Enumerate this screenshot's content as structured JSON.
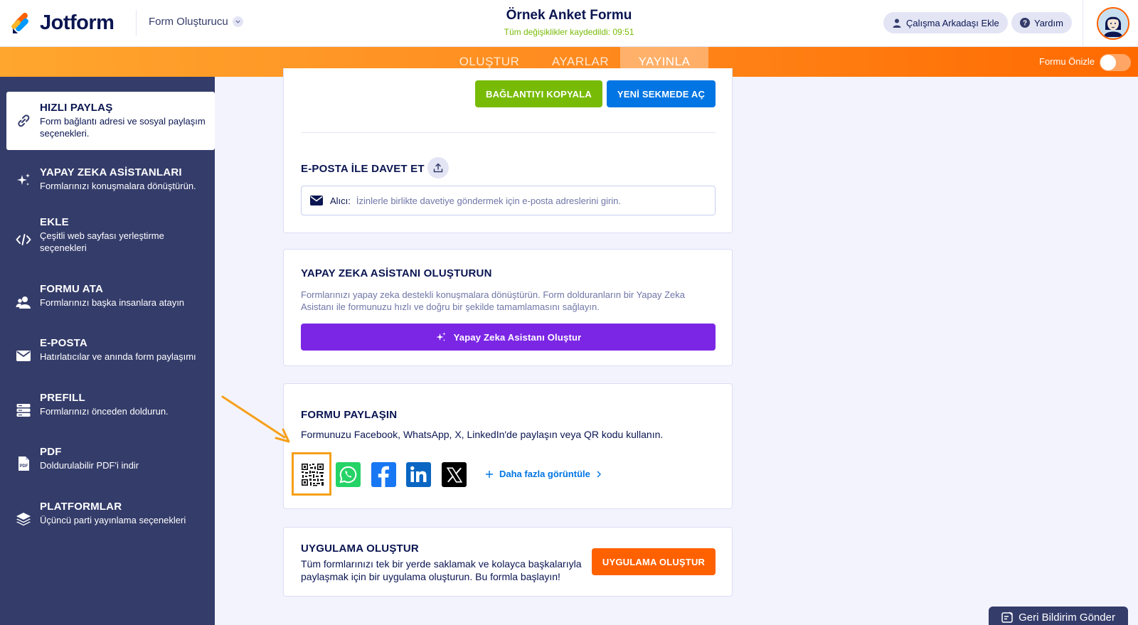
{
  "header": {
    "logo_text": "Jotform",
    "builder_label": "Form Oluşturucu",
    "form_title": "Örnek Anket Formu",
    "saved_status": "Tüm değişiklikler kaydedildi: 09:51",
    "add_collaborator": "Çalışma Arkadaşı Ekle",
    "help": "Yardım"
  },
  "nav": {
    "tabs": [
      "OLUŞTUR",
      "AYARLAR",
      "YAYINLA"
    ],
    "active_tab": "YAYINLA",
    "preview_label": "Formu Önizle",
    "preview_on": false
  },
  "sidebar": {
    "items": [
      {
        "title": "HIZLI PAYLAŞ",
        "desc": "Form bağlantı adresi ve sosyal paylaşım seçenekleri.",
        "icon": "link-icon",
        "active": true
      },
      {
        "title": "YAPAY ZEKA ASİSTANLARI",
        "desc": "Formlarınızı konuşmalara dönüştürün.",
        "icon": "sparkle-icon"
      },
      {
        "title": "EKLE",
        "desc": "Çeşitli web sayfası yerleştirme seçenekleri",
        "icon": "code-icon"
      },
      {
        "title": "FORMU ATA",
        "desc": "Formlarınızı başka insanlara atayın",
        "icon": "users-icon"
      },
      {
        "title": "E-POSTA",
        "desc": "Hatırlatıcılar ve anında form paylaşımı",
        "icon": "mail-icon"
      },
      {
        "title": "PREFILL",
        "desc": "Formlarınızı önceden doldurun.",
        "icon": "prefill-icon"
      },
      {
        "title": "PDF",
        "desc": "Doldurulabilir PDF'i indir",
        "icon": "pdf-icon"
      },
      {
        "title": "PLATFORMLAR",
        "desc": "Üçüncü parti yayınlama seçenekleri",
        "icon": "layers-icon"
      }
    ]
  },
  "link_card": {
    "copy_button": "BAĞLANTIYI KOPYALA",
    "open_button": "YENİ SEKMEDE AÇ",
    "invite_title": "E-POSTA İLE DAVET ET",
    "recipient_label": "Alıcı:",
    "recipient_placeholder": "İzinlerle birlikte davetiye göndermek için e-posta adreslerini girin."
  },
  "ai_card": {
    "title": "YAPAY ZEKA ASİSTANI OLUŞTURUN",
    "desc": "Formlarınızı yapay zeka destekli konuşmalara dönüştürün. Form dolduranların bir Yapay Zeka Asistanı ile formunuzu hızlı ve doğru bir şekilde tamamlamasını sağlayın.",
    "button": "Yapay Zeka Asistanı Oluştur"
  },
  "share_card": {
    "title": "FORMU PAYLAŞIN",
    "desc": "Formunuzu Facebook, WhatsApp, X, LinkedIn'de paylaşın veya QR kodu kullanın.",
    "socials": [
      "qr-code-icon",
      "whatsapp-icon",
      "facebook-icon",
      "linkedin-icon",
      "x-icon"
    ],
    "more_link": "Daha fazla görüntüle"
  },
  "app_card": {
    "title": "UYGULAMA OLUŞTUR",
    "desc": "Tüm formlarınızı tek bir yerde saklamak ve kolayca başkalarıyla paylaşmak için bir uygulama oluşturun. Bu formla başlayın!",
    "button": "UYGULAMA OLUŞTUR"
  },
  "feedback_button": "Geri Bildirim Gönder",
  "colors": {
    "navy": "#0a1551",
    "sidebar": "#343c6a",
    "orange": "#ff6100",
    "green": "#78bb07",
    "blue": "#0075e3",
    "purple": "#7b26e5",
    "annotation": "#f6a01a"
  }
}
